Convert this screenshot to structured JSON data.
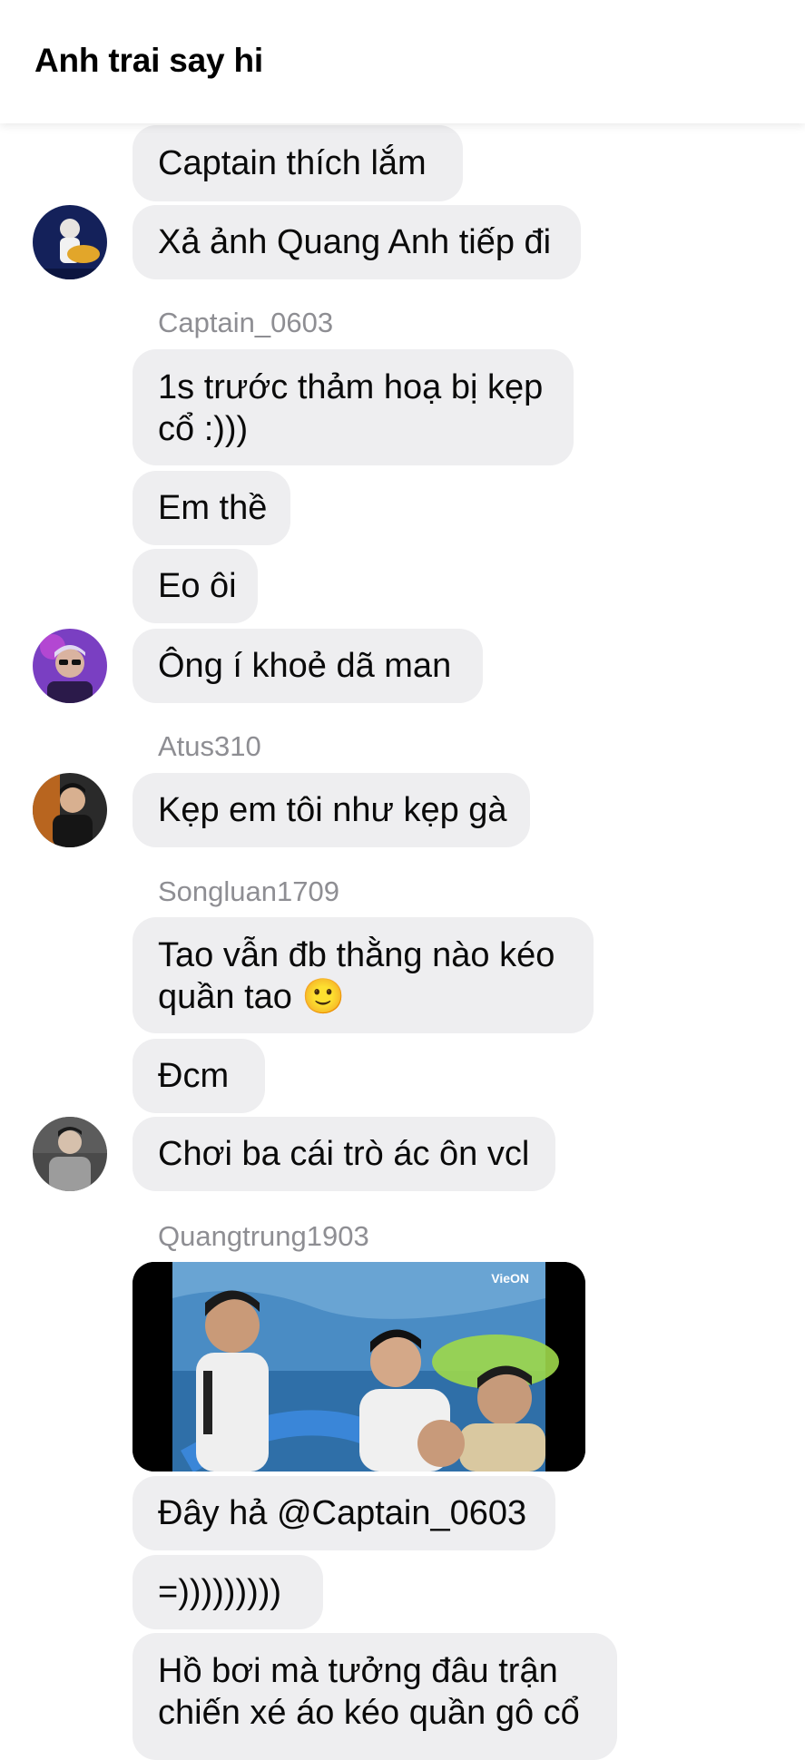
{
  "header": {
    "title": "Anh trai say hi"
  },
  "messages": {
    "m1": "Captain thích lắm",
    "m2": "Xả ảnh Quang Anh tiếp đi",
    "m3": "1s trước thảm hoạ bị kẹp cổ :)))",
    "m4": "Em thề",
    "m5": "Eo ôi",
    "m6": "Ông í khoẻ dã man",
    "m7": "Kẹp em tôi như kẹp gà",
    "m8": "Tao vẫn đb thằng nào kéo quần tao 🙂",
    "m9": "Đcm",
    "m10": "Chơi ba cái trò ác ôn vcl",
    "m11": "Đây hả @Captain_0603",
    "m12": "=)))))))))",
    "m13": "Hồ bơi mà tưởng đâu trận chiến xé áo kéo quần gô cổ"
  },
  "senders": {
    "s1": "Captain_0603",
    "s2": "Atus310",
    "s3": "Songluan1709",
    "s4": "Quangtrung1903"
  },
  "media": {
    "watermark": "VieON"
  }
}
